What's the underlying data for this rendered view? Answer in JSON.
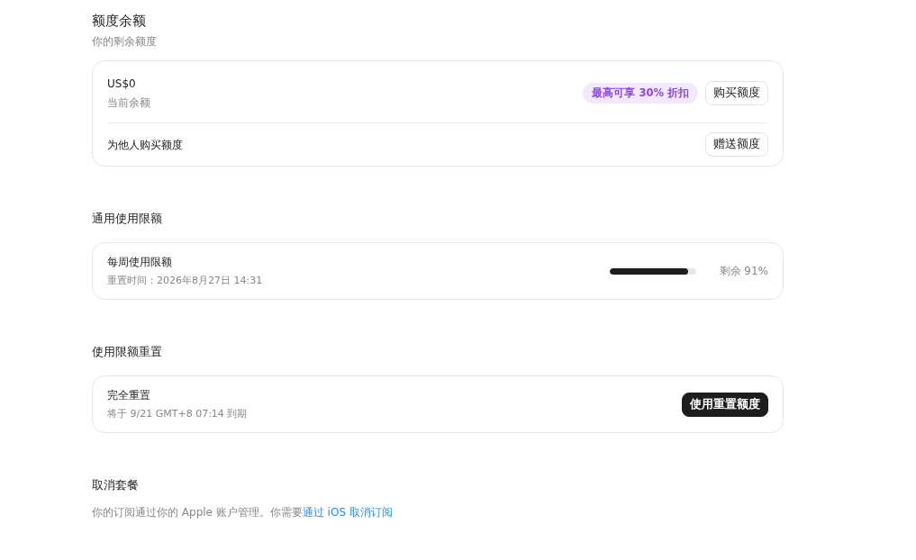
{
  "balance": {
    "title": "额度余额",
    "subtitle": "你的剩余额度",
    "amount": "US$0",
    "amount_label": "当前余额",
    "discount_badge": "最高可享 30% 折扣",
    "buy_button": "购买额度",
    "gift_label": "为他人购买额度",
    "gift_button": "赠送额度"
  },
  "usage_limits": {
    "title": "通用使用限额",
    "name": "每周使用限额",
    "reset_time": "重置时间：2026年8月27日 14:31",
    "level": 0.91,
    "reading": "剩余 91%"
  },
  "limit_reset": {
    "title": "使用限额重置",
    "name": "完全重置",
    "expiry": "将于 9/21 GMT+8 07:14 到期",
    "button": "使用重置额度"
  },
  "cancel_plan": {
    "title": "取消套餐",
    "note": "你的订阅通过你的 Apple 账户管理。你需要",
    "link": "通过 iOS 取消订阅"
  }
}
